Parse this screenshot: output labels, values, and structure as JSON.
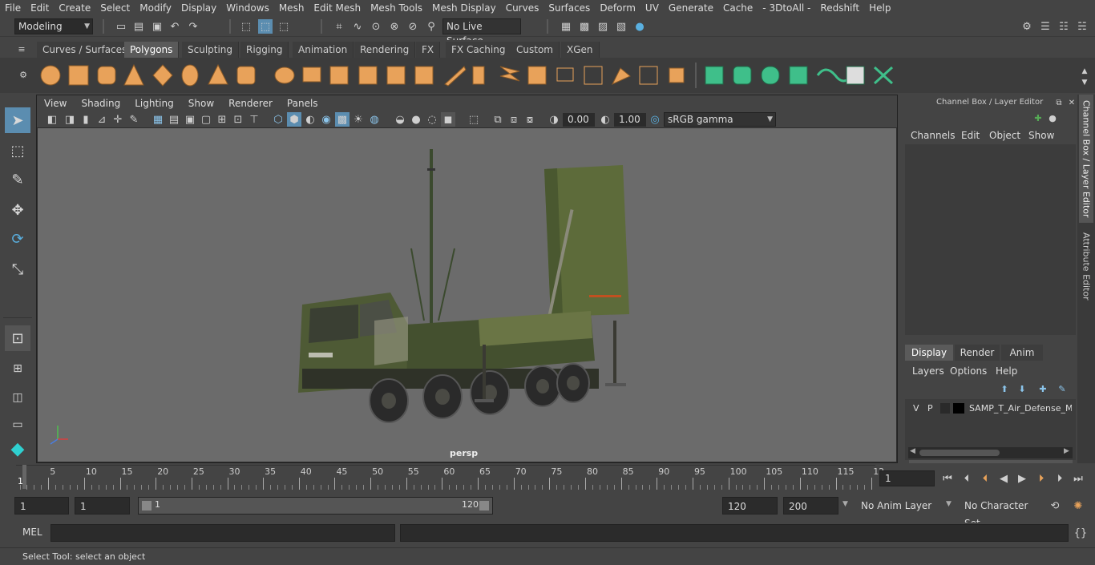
{
  "menubar": {
    "items": [
      "File",
      "Edit",
      "Create",
      "Select",
      "Modify",
      "Display",
      "Windows",
      "Mesh",
      "Edit Mesh",
      "Mesh Tools",
      "Mesh Display",
      "Curves",
      "Surfaces",
      "Deform",
      "UV",
      "Generate",
      "Cache",
      "- 3DtoAll -",
      "Redshift",
      "Help"
    ]
  },
  "statusline": {
    "mode": "Modeling",
    "live_surface": "No Live Surface"
  },
  "shelf": {
    "tabs": [
      "Curves / Surfaces",
      "Polygons",
      "Sculpting",
      "Rigging",
      "Animation",
      "Rendering",
      "FX",
      "FX Caching",
      "Custom",
      "XGen"
    ],
    "active_tab": "Polygons",
    "accent_color": "#e8a25a",
    "accent2_color": "#3fbf8a"
  },
  "viewport": {
    "menu": [
      "View",
      "Shading",
      "Lighting",
      "Show",
      "Renderer",
      "Panels"
    ],
    "exposure": "0.00",
    "gamma": "1.00",
    "color_space": "sRGB gamma",
    "camera_label": "persp"
  },
  "channelbox": {
    "title": "Channel Box / Layer Editor",
    "menu": [
      "Channels",
      "Edit",
      "Object",
      "Show"
    ],
    "layer_tabs": [
      "Display",
      "Render",
      "Anim"
    ],
    "active_layer_tab": "Display",
    "layer_menu": [
      "Layers",
      "Options",
      "Help"
    ],
    "layer": {
      "v": "V",
      "p": "P",
      "name": "SAMP_T_Air_Defense_Mis"
    }
  },
  "sidetabs": {
    "channel": "Channel Box / Layer Editor",
    "attribute": "Attribute Editor"
  },
  "timeslider": {
    "labels": [
      "5",
      "10",
      "15",
      "20",
      "25",
      "30",
      "35",
      "40",
      "45",
      "50",
      "55",
      "60",
      "65",
      "70",
      "75",
      "80",
      "85",
      "90",
      "95",
      "100",
      "105",
      "110",
      "115",
      "12"
    ],
    "current_frame": "1",
    "start_marker": "1"
  },
  "range": {
    "start": "1",
    "playback_start": "1",
    "range_start_label": "1",
    "range_end_label": "120",
    "playback_end": "120",
    "end": "200",
    "anim_layer": "No Anim Layer",
    "char_set": "No Character Set"
  },
  "cmdline": {
    "label": "MEL"
  },
  "helpline": {
    "text": "Select Tool: select an object"
  }
}
